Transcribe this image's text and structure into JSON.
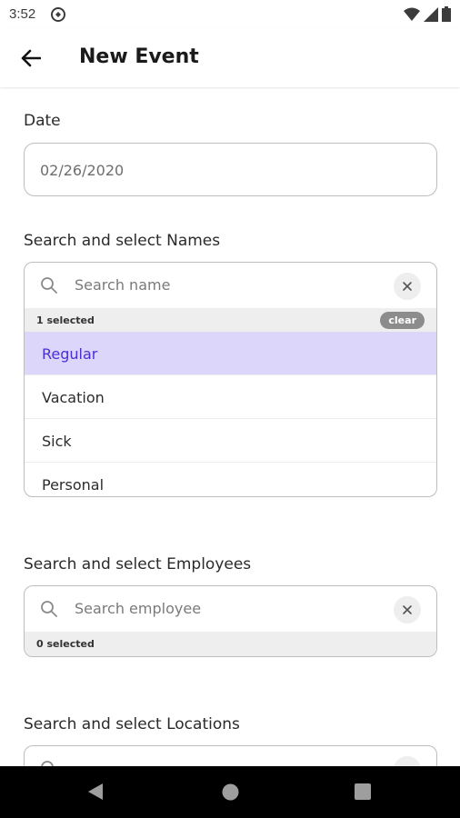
{
  "status_bar": {
    "time": "3:52"
  },
  "app_bar": {
    "title": "New Event"
  },
  "date": {
    "label": "Date",
    "value": "02/26/2020"
  },
  "names": {
    "label": "Search and select Names",
    "placeholder": "Search name",
    "selected_count": "1 selected",
    "clear_label": "clear",
    "options": [
      "Regular",
      "Vacation",
      "Sick",
      "Personal"
    ],
    "selected_option": "Regular"
  },
  "employees": {
    "label": "Search and select Employees",
    "placeholder": "Search employee",
    "selected_count": "0 selected"
  },
  "locations": {
    "label": "Search and select Locations"
  },
  "colors": {
    "accent": "#4a2fd6",
    "selected_bg": "#dcd6fa"
  }
}
